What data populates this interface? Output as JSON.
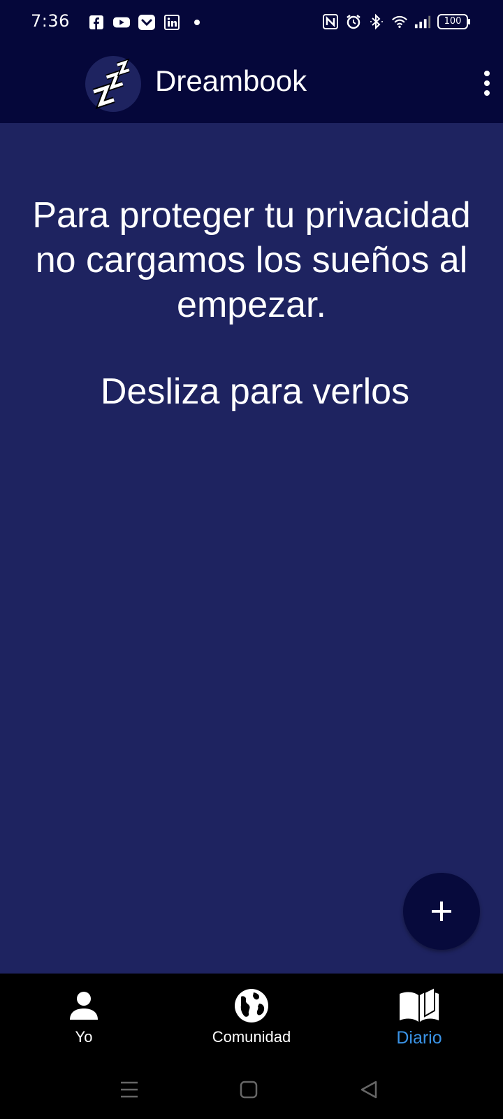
{
  "status_bar": {
    "time": "7:36",
    "battery": "100",
    "left_icons": [
      "facebook-icon",
      "youtube-icon",
      "pocket-icon",
      "linkedin-icon",
      "notification-dot-icon"
    ],
    "right_icons": [
      "nfc-icon",
      "alarm-icon",
      "bluetooth-icon",
      "wifi-icon",
      "signal-icon",
      "battery-icon"
    ]
  },
  "app_bar": {
    "title": "Dreambook",
    "logo": "zzz-sleep-logo",
    "menu_icon": "more-vert-icon"
  },
  "main": {
    "message": "Para proteger tu privacidad no cargamos los sueños al empezar.",
    "hint": "Desliza para verlos"
  },
  "fab": {
    "icon": "plus-icon"
  },
  "bottom_nav": {
    "items": [
      {
        "label": "Yo",
        "icon": "person-icon",
        "active": false
      },
      {
        "label": "Comunidad",
        "icon": "globe-icon",
        "active": false
      },
      {
        "label": "Diario",
        "icon": "book-icon",
        "active": true
      }
    ],
    "active_color": "#3a93e6"
  },
  "system_nav": {
    "buttons": [
      "menu-icon",
      "home-icon",
      "back-icon"
    ]
  },
  "colors": {
    "background": "#1e2360",
    "app_bar": "#05073a",
    "fab": "#070a3c",
    "nav_background": "#000000"
  }
}
